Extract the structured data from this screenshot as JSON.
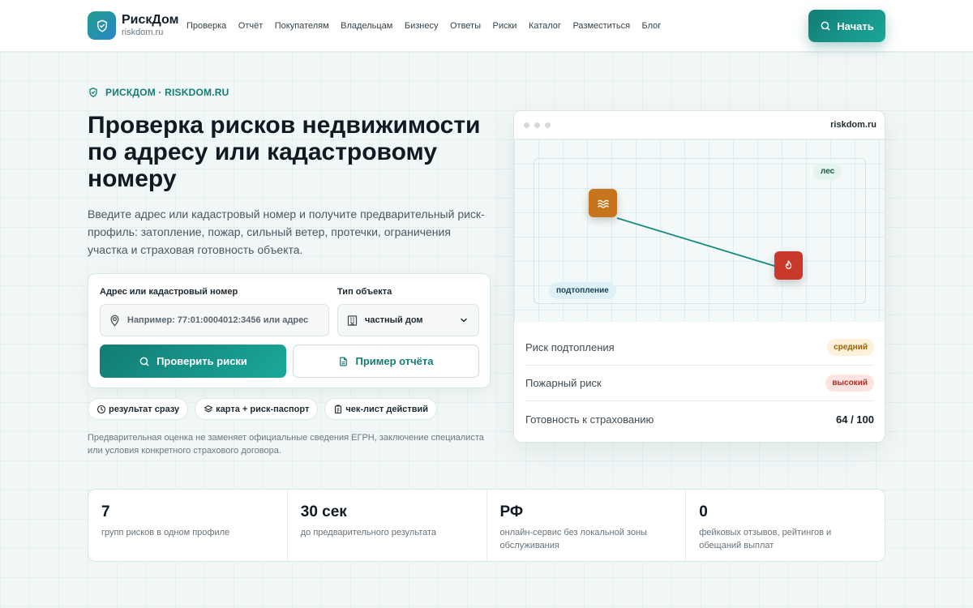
{
  "header": {
    "brand": "РискДом",
    "brand_sub": "riskdom.ru",
    "nav": [
      "Проверка",
      "Отчёт",
      "Покупателям",
      "Владельцам",
      "Бизнесу",
      "Ответы",
      "Риски",
      "Каталог",
      "Разместиться",
      "Блог"
    ],
    "start_label": "Начать"
  },
  "hero": {
    "eyebrow": "РИСКДОМ · RISKDOM.RU",
    "title": "Проверка рисков недвижимости по адресу или кадастровому номеру",
    "lead": "Введите адрес или кадастровый номер и получите предварительный риск-профиль: затопление, пожар, сильный ветер, протечки, ограничения участка и страховая готовность объекта."
  },
  "form": {
    "address_label": "Адрес или кадастровый номер",
    "address_placeholder": "Например: 77:01:0004012:3456 или адрес",
    "type_label": "Тип объекта",
    "type_value": "частный дом",
    "check_label": "Проверить риски",
    "sample_label": "Пример отчёта"
  },
  "chips": [
    "результат сразу",
    "карта + риск-паспорт",
    "чек-лист действий"
  ],
  "disclaimer": "Предварительная оценка не заменяет официальные сведения ЕГРН, заключение специалиста или условия конкретного страхового договора.",
  "preview": {
    "host": "riskdom.ru",
    "tag_forest": "лес",
    "tag_flood": "подтопление",
    "rows": [
      {
        "label": "Риск подтопления",
        "badge": "средний"
      },
      {
        "label": "Пожарный риск",
        "badge": "высокий"
      },
      {
        "label": "Готовность к страхованию",
        "score": "64 / 100"
      }
    ]
  },
  "stats": [
    {
      "num": "7",
      "desc": "групп рисков в одном профиле"
    },
    {
      "num": "30 сек",
      "desc": "до предварительного результата"
    },
    {
      "num": "РФ",
      "desc": "онлайн-сервис без локальной зоны обслуживания"
    },
    {
      "num": "0",
      "desc": "фейковых отзывов, рейтингов и обещаний выплат"
    }
  ],
  "colors": {
    "accent": "#137c74",
    "warning": "#c7751c",
    "danger": "#c8392c"
  }
}
